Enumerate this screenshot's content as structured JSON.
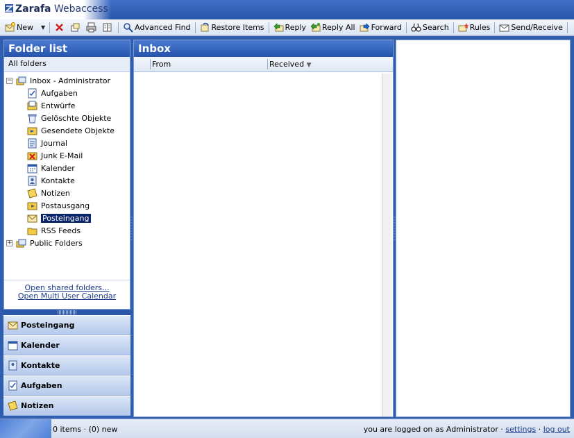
{
  "header": {
    "logo_brand": "Zarafa",
    "logo_product": "Webaccess"
  },
  "toolbar": {
    "new": "New",
    "advanced_find": "Advanced Find",
    "restore_items": "Restore Items",
    "reply": "Reply",
    "reply_all": "Reply All",
    "forward": "Forward",
    "search": "Search",
    "rules": "Rules",
    "send_receive": "Send/Receive"
  },
  "folder_panel": {
    "title": "Folder list",
    "subheader": "All folders",
    "root": "Inbox - Administrator",
    "folders": [
      "Aufgaben",
      "Entwürfe",
      "Gelöschte Objekte",
      "Gesendete Objekte",
      "Journal",
      "Junk E-Mail",
      "Kalender",
      "Kontakte",
      "Notizen",
      "Postausgang",
      "Posteingang",
      "RSS Feeds"
    ],
    "public": "Public Folders",
    "selected": "Posteingang",
    "link_shared": "Open shared folders...",
    "link_calendar": "Open Multi User Calendar"
  },
  "shortcuts": [
    "Posteingang",
    "Kalender",
    "Kontakte",
    "Aufgaben",
    "Notizen"
  ],
  "inbox": {
    "title": "Inbox",
    "col_from": "From",
    "col_received": "Received"
  },
  "status": {
    "count": "0 items · (0) new",
    "logged_in": "you are logged on as Administrator ·",
    "settings": "settings",
    "dot": "·",
    "logout": "log out"
  },
  "colors": {
    "accent": "#2a56aa",
    "selection": "#0a246a",
    "link": "#1b3a8c"
  }
}
